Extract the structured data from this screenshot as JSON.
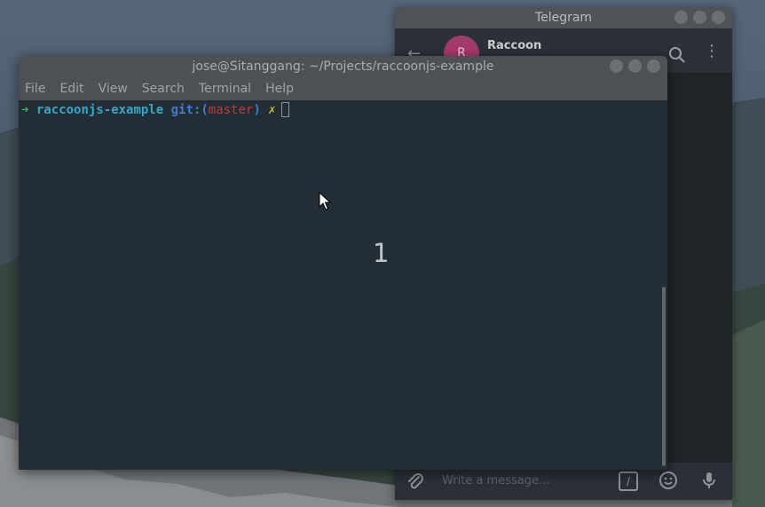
{
  "telegram": {
    "title": "Telegram",
    "contact_name": "Raccoon",
    "avatar_initial": "R",
    "compose_placeholder": "Write a message...",
    "command_glyph": "/",
    "icons": [
      "back-arrow-icon",
      "search-icon",
      "more-vertical-icon",
      "paperclip-icon",
      "command-icon",
      "emoji-icon",
      "microphone-icon"
    ]
  },
  "terminal": {
    "title": "jose@Sitanggang: ~/Projects/raccoonjs-example",
    "menu": [
      "File",
      "Edit",
      "View",
      "Search",
      "Terminal",
      "Help"
    ],
    "prompt": {
      "arrow": "➜",
      "directory": "raccoonjs-example",
      "git_prefix": "git:(",
      "branch": "master",
      "git_suffix": ")",
      "dirty_mark": "✗"
    },
    "overlay_text": "1"
  },
  "colors": {
    "terminal_bg": "#232d35",
    "titlebar_bg": "#4d5156",
    "prompt_arrow": "#3bb84c",
    "prompt_dir": "#3aa5c4",
    "branch": "#c13a3a",
    "dirty_mark": "#d4b93c"
  }
}
